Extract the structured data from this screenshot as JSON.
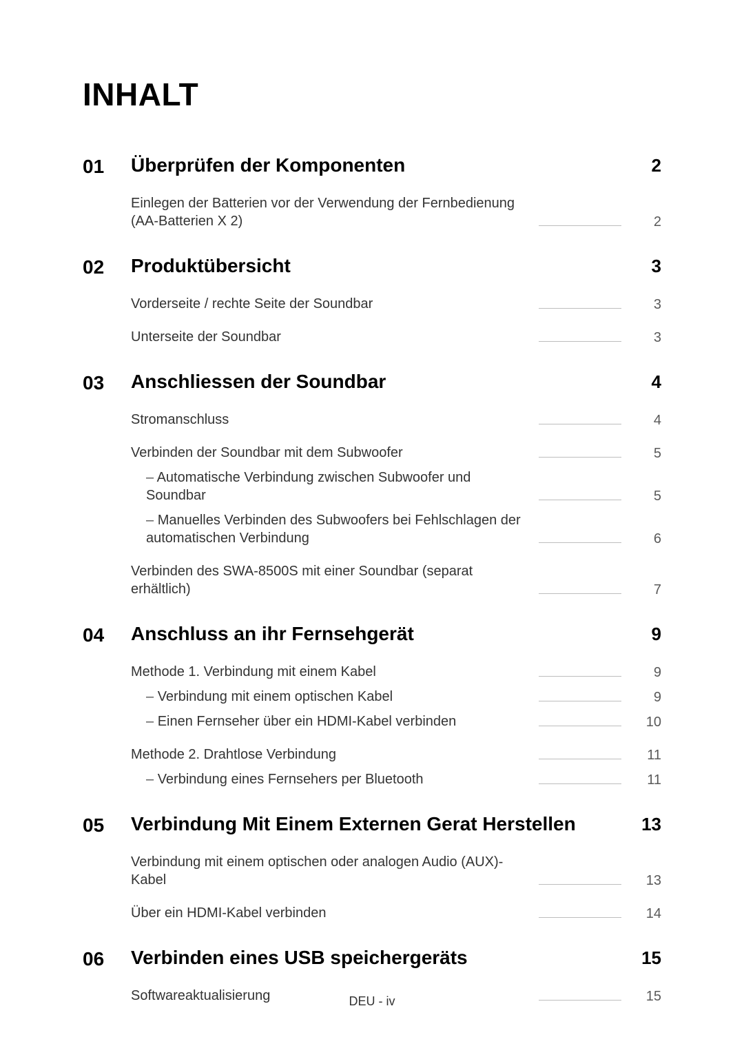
{
  "title": "INHALT",
  "footer": "DEU - iv",
  "sections": [
    {
      "num": "01",
      "title": "Überprüfen der Komponenten",
      "page": "2",
      "entries": [
        {
          "text": "Einlegen der Batterien vor der Verwendung der Fernbedienung (AA-Batterien X 2)",
          "page": "2",
          "level": 0,
          "group_start": true
        }
      ]
    },
    {
      "num": "02",
      "title": "Produktübersicht",
      "page": "3",
      "entries": [
        {
          "text": "Vorderseite / rechte Seite der Soundbar",
          "page": "3",
          "level": 0,
          "group_start": true
        },
        {
          "text": "Unterseite der Soundbar",
          "page": "3",
          "level": 0,
          "group_start": true
        }
      ]
    },
    {
      "num": "03",
      "title": "Anschliessen der Soundbar",
      "page": "4",
      "entries": [
        {
          "text": "Stromanschluss",
          "page": "4",
          "level": 0,
          "group_start": true
        },
        {
          "text": "Verbinden der Soundbar mit dem Subwoofer",
          "page": "5",
          "level": 0,
          "group_start": true
        },
        {
          "text": "Automatische Verbindung zwischen Subwoofer und Soundbar",
          "page": "5",
          "level": 1
        },
        {
          "text": "Manuelles Verbinden des Subwoofers bei Fehlschlagen der automatischen Verbindung",
          "page": "6",
          "level": 1
        },
        {
          "text": "Verbinden des SWA-8500S mit einer Soundbar (separat erhältlich)",
          "page": "7",
          "level": 0,
          "group_start": true
        }
      ]
    },
    {
      "num": "04",
      "title": "Anschluss an ihr Fernsehgerät",
      "page": "9",
      "entries": [
        {
          "text": "Methode 1. Verbindung mit einem Kabel",
          "page": "9",
          "level": 0,
          "group_start": true
        },
        {
          "text": "Verbindung mit einem optischen Kabel",
          "page": "9",
          "level": 1
        },
        {
          "text": "Einen Fernseher über ein HDMI-Kabel verbinden",
          "page": "10",
          "level": 1
        },
        {
          "text": "Methode 2. Drahtlose Verbindung",
          "page": "11",
          "level": 0,
          "group_start": true
        },
        {
          "text": "Verbindung eines Fernsehers per Bluetooth",
          "page": "11",
          "level": 1
        }
      ]
    },
    {
      "num": "05",
      "title": "Verbindung Mit Einem Externen Gerat Herstellen",
      "page": "13",
      "entries": [
        {
          "text": "Verbindung mit einem optischen oder analogen Audio (AUX)-Kabel",
          "page": "13",
          "level": 0,
          "group_start": true
        },
        {
          "text": "Über ein HDMI-Kabel verbinden",
          "page": "14",
          "level": 0,
          "group_start": true
        }
      ]
    },
    {
      "num": "06",
      "title": "Verbinden eines USB speichergeräts",
      "page": "15",
      "entries": [
        {
          "text": "Softwareaktualisierung",
          "page": "15",
          "level": 0,
          "group_start": true
        }
      ]
    }
  ]
}
